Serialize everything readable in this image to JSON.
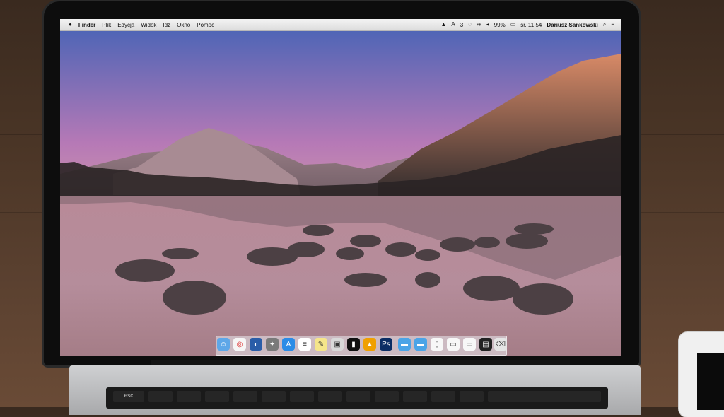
{
  "menubar": {
    "apple": "",
    "items": [
      "Finder",
      "Plik",
      "Edycja",
      "Widok",
      "Idź",
      "Okno",
      "Pomoc"
    ],
    "status": {
      "adobe_count": "3",
      "battery": "99%",
      "clock": "śr. 11:54",
      "user": "Dariusz Sankowski"
    }
  },
  "dock": {
    "apps": [
      "finder-icon",
      "chrome-icon",
      "firefox-icon",
      "launchpad-icon",
      "app-store-icon",
      "text-icon",
      "notes-icon",
      "preview-icon",
      "terminal-icon",
      "vlc-icon",
      "photoshop-icon",
      "folder-icon",
      "folder-icon",
      "document-icon",
      "document-icon",
      "document-icon",
      "terminal-window-icon",
      "trash-icon"
    ]
  },
  "keyboard": {
    "labels": [
      "esc",
      "",
      "",
      "",
      "",
      "",
      "",
      "",
      "",
      "",
      "",
      "",
      "",
      ""
    ]
  },
  "colors": {
    "menubar": "#e6e6e6",
    "sky_top": "#5f6fb7",
    "sky_mid": "#c07fb0",
    "sky_low": "#d99a9a",
    "water": "#b2869b"
  }
}
